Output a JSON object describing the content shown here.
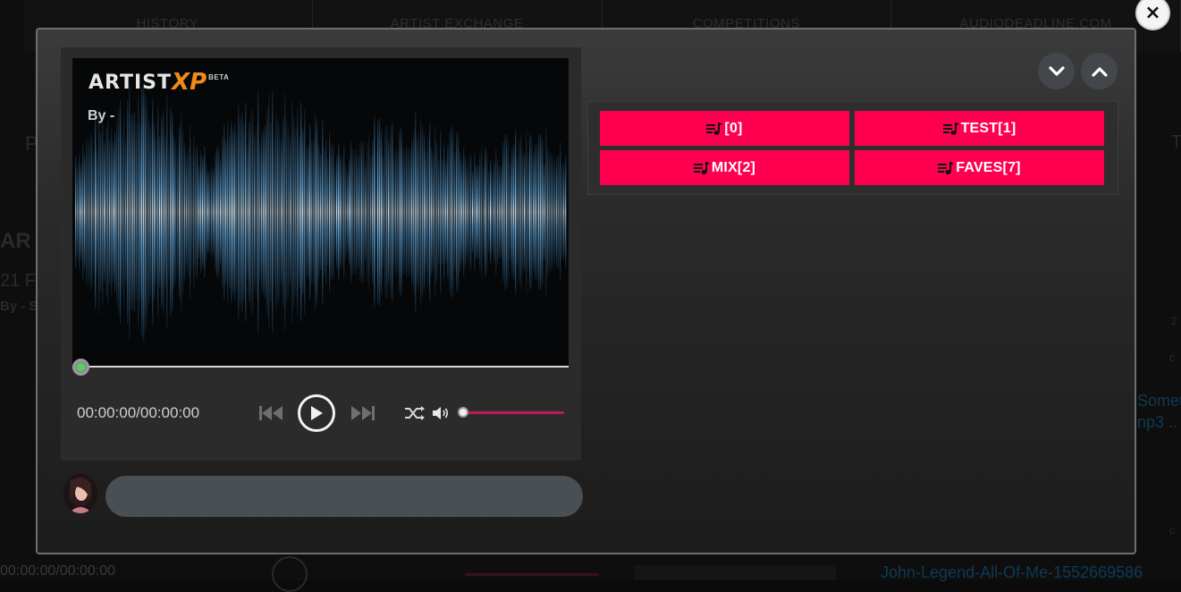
{
  "background": {
    "nav": [
      "HISTORY",
      "ARTIST EXCHANGE",
      "COMPETITIONS",
      "AUDIODEADLINE.COM"
    ],
    "fragments": [
      "P",
      "AR",
      "21 F",
      "By - S",
      "Someth",
      "np3 ..",
      "T",
      "2",
      "c",
      "c"
    ],
    "bottom_time": "00:00:00/00:00:00",
    "bottom_track": "John-Legend-All-Of-Me-1552669586"
  },
  "close_label": "×",
  "player": {
    "logo": {
      "word": "ARTIST",
      "accent": "XP",
      "badge": "BETA"
    },
    "by_line": "By -",
    "time": "00:00:00/00:00:00",
    "volume": 1.0,
    "progress": 0.0,
    "icons": [
      "skip-back-icon",
      "play-icon",
      "skip-forward-icon",
      "shuffle-icon",
      "volume-icon"
    ]
  },
  "comment": {
    "value": "",
    "placeholder": ""
  },
  "panel": {
    "nav_icons": [
      "chevron-down-icon",
      "chevron-up-icon"
    ],
    "playlists": [
      {
        "label": "[0]"
      },
      {
        "label": "TEST[1]"
      },
      {
        "label": "MIX[2]"
      },
      {
        "label": "FAVES[7]"
      }
    ]
  },
  "colors": {
    "accent": "#ff0050",
    "progress_dot": "#53d35b",
    "volume": "#c2185b",
    "logo_accent": "#f08a1a"
  }
}
